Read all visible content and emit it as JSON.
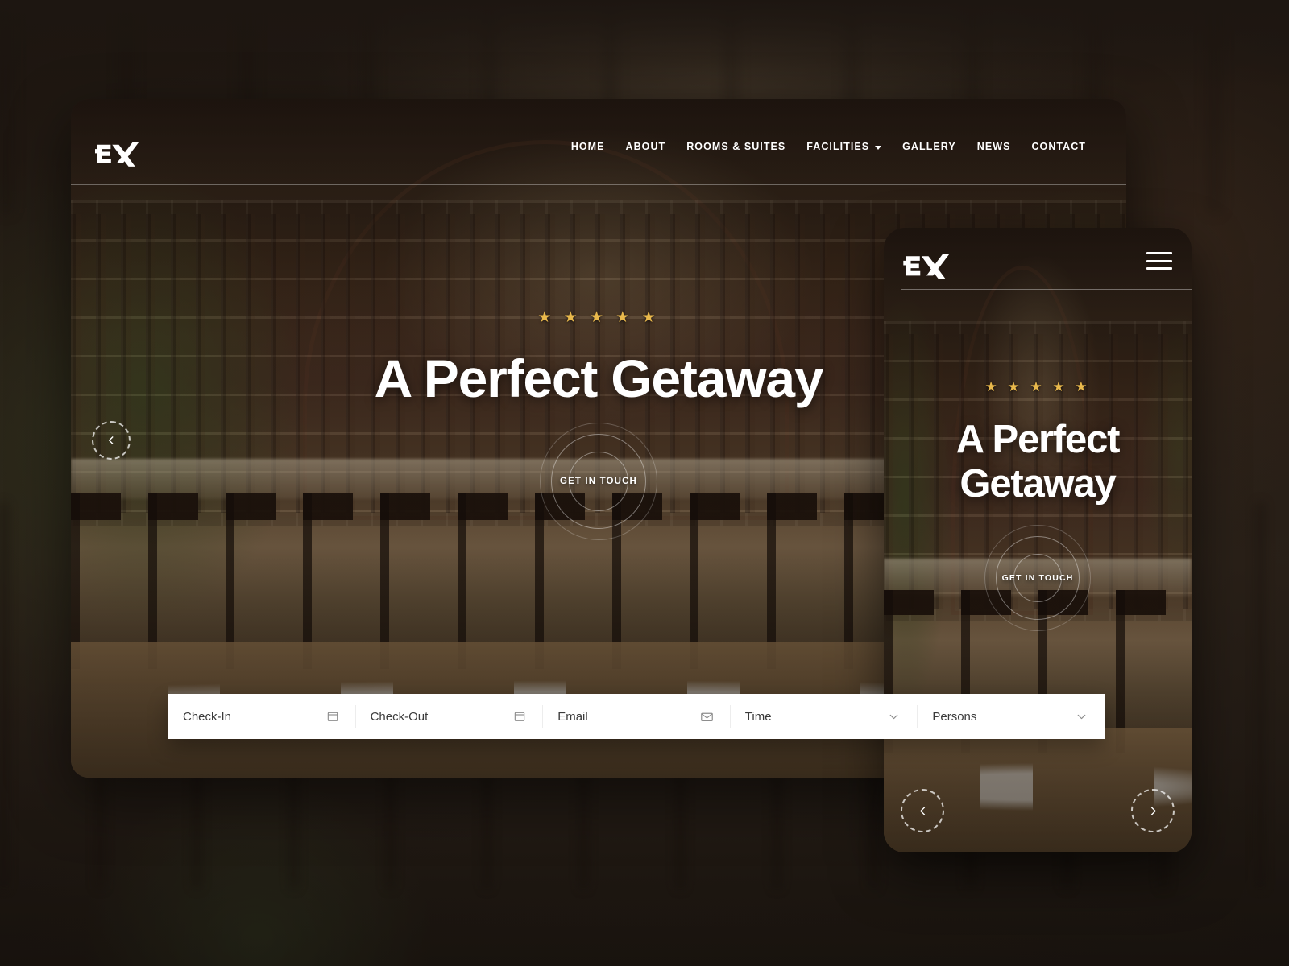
{
  "site": {
    "brand": "EX",
    "brand_alt": "EX hotel logo"
  },
  "desktop": {
    "nav": [
      {
        "label": "HOME",
        "has_dropdown": false
      },
      {
        "label": "ABOUT",
        "has_dropdown": false
      },
      {
        "label": "ROOMS & SUITES",
        "has_dropdown": false
      },
      {
        "label": "FACILITIES",
        "has_dropdown": true
      },
      {
        "label": "GALLERY",
        "has_dropdown": false
      },
      {
        "label": "NEWS",
        "has_dropdown": false
      },
      {
        "label": "CONTACT",
        "has_dropdown": false
      }
    ],
    "hero": {
      "stars": "★ ★ ★ ★ ★",
      "star_count": 5,
      "title": "A Perfect Getaway",
      "cta_label": "GET IN TOUCH"
    },
    "slider": {
      "prev_label": "Previous slide",
      "next_label": "Next slide"
    },
    "booking": {
      "fields": [
        {
          "label": "Check-In",
          "icon": "calendar-icon"
        },
        {
          "label": "Check-Out",
          "icon": "calendar-icon"
        },
        {
          "label": "Email",
          "icon": "envelope-icon"
        },
        {
          "label": "Time",
          "icon": "chevron-down-icon"
        },
        {
          "label": "Persons",
          "icon": "chevron-down-icon"
        }
      ]
    }
  },
  "mobile": {
    "menu_label": "Open menu",
    "hero": {
      "stars": "★ ★ ★ ★ ★",
      "title_line1": "A Perfect",
      "title_line2": "Getaway",
      "cta_label": "GET IN TOUCH"
    },
    "slider": {
      "prev_label": "Previous slide",
      "next_label": "Next slide"
    }
  },
  "colors": {
    "star_gold": "#e9b94c",
    "panel_white": "#ffffff",
    "text_dark": "#3b3b3b",
    "backdrop": "#241c16"
  }
}
